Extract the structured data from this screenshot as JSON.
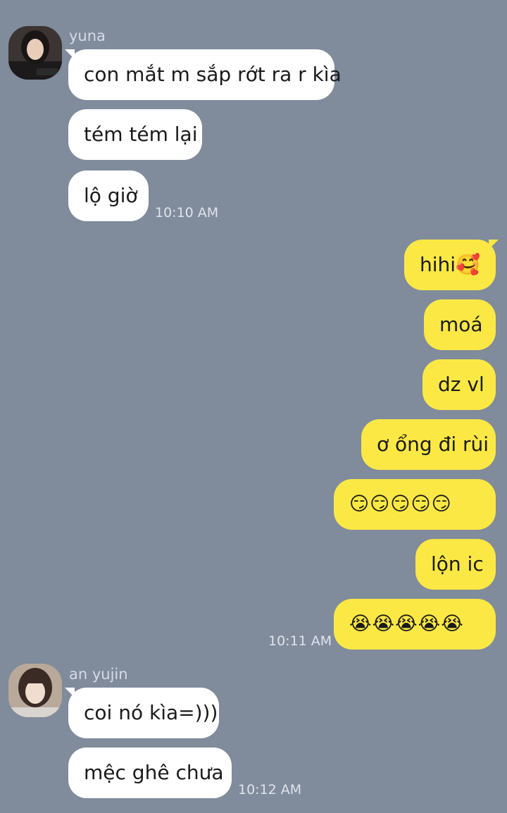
{
  "groups": [
    {
      "sender": "yuna",
      "avatar": "avatar-yuna",
      "messages": [
        "con mắt m sắp rớt ra r kìa",
        "tém tém lại",
        "lộ giờ"
      ],
      "time": "10:10 AM"
    },
    {
      "sender": "",
      "messages": [
        "hihi🥰",
        "moá",
        "dz vl",
        "ơ ổng đi rùi",
        "😏😏😏😏😏",
        "lộn ic",
        "😭😭😭😭😭"
      ],
      "time": "10:11 AM"
    },
    {
      "sender": "an yujin",
      "avatar": "avatar-an-yujin",
      "messages": [
        "coi nó kìa=)))",
        "mệc ghê chưa"
      ],
      "time": "10:12 AM"
    }
  ],
  "colors": {
    "background": "#808b9c",
    "incoming_bubble": "#ffffff",
    "outgoing_bubble": "#fbe845"
  }
}
